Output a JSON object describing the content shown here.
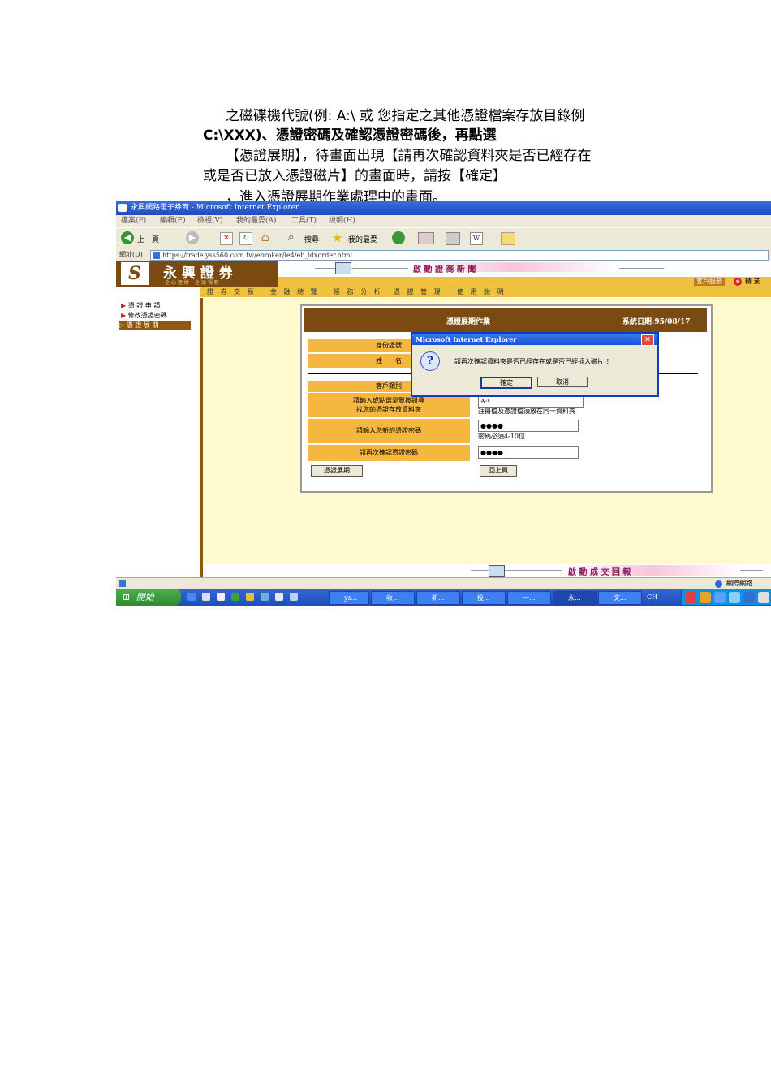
{
  "doc": {
    "line1": "之磁碟機代號(例: A:\\ 或 您指定之其他憑證檔案存放目錄例",
    "line2": "C:\\XXX)、憑證密碼及確認憑證密碼後，再點選",
    "line3": "【憑證展期】，待畫面出現【請再次確認資料夾是否已經存在",
    "line4": "或是否已放入憑證磁片】的畫面時，請按【確定】",
    "line5": "，進入憑證展期作業處理中的畫面。"
  },
  "browser": {
    "title": "永興網路電子券商 - Microsoft Internet Explorer",
    "menu": [
      "檔案(F)",
      "編輯(E)",
      "檢視(V)",
      "我的最愛(A)",
      "工具(T)",
      "說明(H)"
    ],
    "back_label": "上一頁",
    "search_label": "搜尋",
    "favorites_label": "我的最愛",
    "address_label": "網址(D)",
    "url": "https://trade.yss560.com.tw/ebroker/ie4/eb_idxorder.html",
    "status_zone": "網際網路"
  },
  "site": {
    "brand": "永 興 證 券",
    "slogan": "全 心 理 財 • 全 球 視 野",
    "marquee_top": "啟 動 證 商 新 聞",
    "marquee_bottom": "啟 動 成 交 回 報",
    "top_link": "客戶服務",
    "logout_label": "登出",
    "logout_tail": "精 業",
    "nav": [
      "證 券 交 易",
      "金 融 總 覽",
      "帳 務 分 析",
      "憑 證 管 理",
      "使 用 說 明"
    ],
    "sidebar": [
      "憑 證 申 請",
      "修改憑證密碼",
      "憑 證 展 期"
    ]
  },
  "form": {
    "title": "憑證展期作業",
    "system_date": "系統日期:95/08/17",
    "id_label": "身份證號",
    "name_label": "姓　　名",
    "type_label": "客戶類別",
    "folder_label_1": "請輸入或點選瀏覽按鈕尋",
    "folder_label_2": "找您的憑證存放資料夾",
    "folder_value": "A:\\",
    "folder_note": "註冊檔及憑證檔須放在同一資料夾",
    "pwd_label": "請輸入您新的憑證密碼",
    "pwd_value": "●●●●",
    "pwd_note": "密碼必須4-10位",
    "confirm_label": "請再次確認憑證密碼",
    "confirm_value": "●●●●",
    "renew_button": "憑證展期",
    "back_button": "回上頁"
  },
  "dialog": {
    "title": "Microsoft Internet Explorer",
    "message": "請再次確認資料夾是否已經存在或是否已經插入磁片!!",
    "ok": "確定",
    "cancel": "取消"
  },
  "taskbar": {
    "start": "開始",
    "tasks": [
      "ys...",
      "收...",
      "新...",
      "投...",
      "—...",
      "永...",
      "文..."
    ],
    "lang": "CH"
  }
}
